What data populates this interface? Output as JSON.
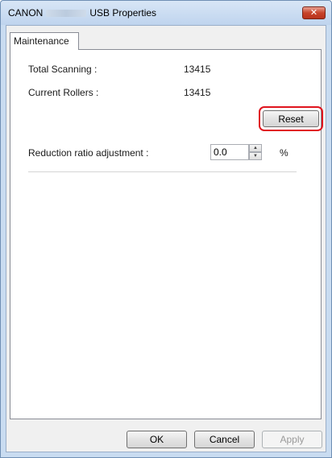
{
  "window": {
    "title_prefix": "CANON",
    "title_suffix": "USB Properties",
    "close_glyph": "✕"
  },
  "tabs": [
    {
      "label": "Maintenance",
      "selected": true
    }
  ],
  "maintenance": {
    "total_scanning_label": "Total Scanning :",
    "total_scanning_value": "13415",
    "current_rollers_label": "Current Rollers :",
    "current_rollers_value": "13415",
    "reset_label": "Reset",
    "reduction_label": "Reduction ratio adjustment :",
    "reduction_value": "0.0",
    "reduction_unit": "%"
  },
  "footer": {
    "ok_label": "OK",
    "cancel_label": "Cancel",
    "apply_label": "Apply"
  },
  "icons": {
    "spin_up": "▲",
    "spin_down": "▼"
  },
  "colors": {
    "highlight": "#e0141e",
    "close_button": "#c7432a",
    "titlebar": "#c9dcf1"
  }
}
